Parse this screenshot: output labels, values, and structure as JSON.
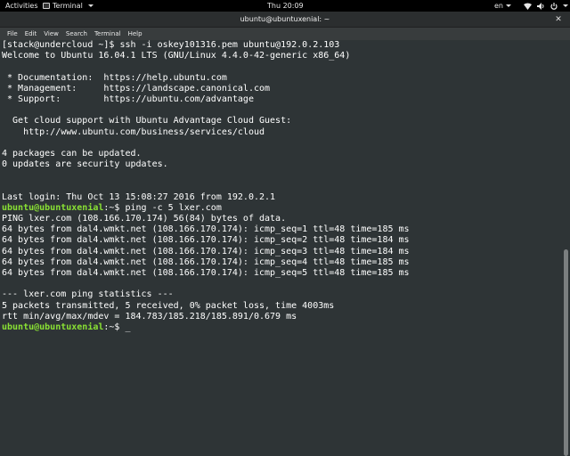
{
  "topbar": {
    "activities": "Activities",
    "app_name": "Terminal",
    "clock": "Thu 20:09",
    "lang": "en"
  },
  "window": {
    "title": "ubuntu@ubuntuxenial: ~",
    "close_symbol": "✕"
  },
  "menu": [
    "File",
    "Edit",
    "View",
    "Search",
    "Terminal",
    "Help"
  ],
  "terminal": {
    "lines": [
      {
        "text": "[stack@undercloud ~]$ ssh -i oskey101316.pem ubuntu@192.0.2.103"
      },
      {
        "text": "Welcome to Ubuntu 16.04.1 LTS (GNU/Linux 4.4.0-42-generic x86_64)"
      },
      {
        "text": ""
      },
      {
        "text": " * Documentation:  https://help.ubuntu.com"
      },
      {
        "text": " * Management:     https://landscape.canonical.com"
      },
      {
        "text": " * Support:        https://ubuntu.com/advantage"
      },
      {
        "text": ""
      },
      {
        "text": "  Get cloud support with Ubuntu Advantage Cloud Guest:"
      },
      {
        "text": "    http://www.ubuntu.com/business/services/cloud"
      },
      {
        "text": ""
      },
      {
        "text": "4 packages can be updated."
      },
      {
        "text": "0 updates are security updates."
      },
      {
        "text": ""
      },
      {
        "text": ""
      },
      {
        "text": "Last login: Thu Oct 13 15:08:27 2016 from 192.0.2.1"
      },
      {
        "prompt": "ubuntu@ubuntuxenial",
        "suffix": ":~$ ping -c 5 lxer.com"
      },
      {
        "text": "PING lxer.com (108.166.170.174) 56(84) bytes of data."
      },
      {
        "text": "64 bytes from dal4.wmkt.net (108.166.170.174): icmp_seq=1 ttl=48 time=185 ms"
      },
      {
        "text": "64 bytes from dal4.wmkt.net (108.166.170.174): icmp_seq=2 ttl=48 time=184 ms"
      },
      {
        "text": "64 bytes from dal4.wmkt.net (108.166.170.174): icmp_seq=3 ttl=48 time=184 ms"
      },
      {
        "text": "64 bytes from dal4.wmkt.net (108.166.170.174): icmp_seq=4 ttl=48 time=185 ms"
      },
      {
        "text": "64 bytes from dal4.wmkt.net (108.166.170.174): icmp_seq=5 ttl=48 time=185 ms"
      },
      {
        "text": ""
      },
      {
        "text": "--- lxer.com ping statistics ---"
      },
      {
        "text": "5 packets transmitted, 5 received, 0% packet loss, time 4003ms"
      },
      {
        "text": "rtt min/avg/max/mdev = 184.783/185.218/185.891/0.679 ms"
      },
      {
        "prompt": "ubuntu@ubuntuxenial",
        "suffix": ":~$ _"
      }
    ]
  },
  "colors": {
    "terminal_bg": "#2e3436",
    "prompt": "#8ae234",
    "text": "#ffffff"
  },
  "icons": {
    "app": "terminal-icon",
    "close": "close-icon",
    "network": "network-icon",
    "volume": "volume-icon",
    "power": "power-icon"
  }
}
